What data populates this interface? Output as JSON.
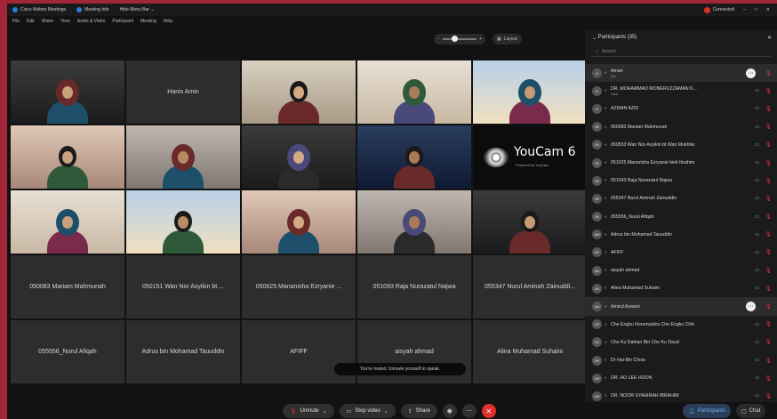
{
  "app": {
    "title_items": [
      "Cisco Webex Meetings",
      "Meeting Info",
      "Hide Menu Bar"
    ],
    "connection": "Connected",
    "window_controls": [
      "–",
      "□",
      "✕"
    ]
  },
  "menu": [
    "File",
    "Edit",
    "Share",
    "View",
    "Audio & Video",
    "Participant",
    "Meeting",
    "Help"
  ],
  "grid_controls": {
    "layout_label": "Layout"
  },
  "tiles": [
    {
      "type": "video",
      "label": ""
    },
    {
      "type": "name",
      "label": "Hanis Amin"
    },
    {
      "type": "video",
      "label": ""
    },
    {
      "type": "video",
      "label": ""
    },
    {
      "type": "video",
      "label": ""
    },
    {
      "type": "video",
      "label": ""
    },
    {
      "type": "video",
      "label": ""
    },
    {
      "type": "video",
      "label": ""
    },
    {
      "type": "video",
      "label": ""
    },
    {
      "type": "youcam",
      "label": "YouCam 6",
      "sub": "Powered by YouCam"
    },
    {
      "type": "video",
      "label": ""
    },
    {
      "type": "video",
      "label": ""
    },
    {
      "type": "video",
      "label": ""
    },
    {
      "type": "video",
      "label": ""
    },
    {
      "type": "video",
      "label": ""
    },
    {
      "type": "name",
      "label": "050083 Mariam Mahmunah"
    },
    {
      "type": "name",
      "label": "050151 Wan Nor Asyikin bt ..."
    },
    {
      "type": "name",
      "label": "050625 Mananisha Ezryanie ..."
    },
    {
      "type": "name",
      "label": "051093 Raja Nurazatul Najwa"
    },
    {
      "type": "name",
      "label": "055347 Nurul Aminah Zainuddi..."
    },
    {
      "type": "name",
      "label": "055556_Nurul Afiqah"
    },
    {
      "type": "name",
      "label": "Adrus bin Mohamad Tauuddin"
    },
    {
      "type": "name",
      "label": "AFIFF"
    },
    {
      "type": "name",
      "label": "aisyah ahmad"
    },
    {
      "type": "name",
      "label": "Alina Muhamad Suhaini"
    }
  ],
  "toast": "You're muted. Unmute yourself to speak.",
  "controls": {
    "mute": "Unmute",
    "video": "Stop video",
    "share": "Share"
  },
  "side_buttons": {
    "participants": "Participants",
    "chat": "Chat"
  },
  "participants": {
    "title": "Participants (35)",
    "search_placeholder": "Search",
    "rows": [
      {
        "initials": "A",
        "name": "Aman",
        "role": "Me",
        "sel": true,
        "more": true
      },
      {
        "initials": "D",
        "name": "DR. MOHAMMAD MONERUZZAMAN K...",
        "role": "Host"
      },
      {
        "initials": "A",
        "name": "AZMAN AZID"
      },
      {
        "initials": "05",
        "name": "050083 Mariam Mahmunah"
      },
      {
        "initials": "05",
        "name": "050553 Wan Nor Asyikin bt Wan Mukhtar"
      },
      {
        "initials": "05",
        "name": "051025 Manarisha Ezryanie binti Ibrahim"
      },
      {
        "initials": "05",
        "name": "051093 Raja Nurazatul Najwa"
      },
      {
        "initials": "05",
        "name": "055347 Nurul Aminah Zainuddin"
      },
      {
        "initials": "05",
        "name": "055556_Nurul Afiqah"
      },
      {
        "initials": "AM",
        "name": "Adrus bin Mohamad Tauuddin"
      },
      {
        "initials": "AF",
        "name": "AFIFF"
      },
      {
        "initials": "AA",
        "name": "aisyah ahmad"
      },
      {
        "initials": "AS",
        "name": "Alina Muhamad Suhaini"
      },
      {
        "initials": "AA",
        "name": "Amirul Azwani",
        "sel": true,
        "more": true
      },
      {
        "initials": "CE",
        "name": "Che Engku Norumaidza Che Engku Chik"
      },
      {
        "initials": "CK",
        "name": "Che Ku Dahlan Bin Che Ku Daud"
      },
      {
        "initials": "DR",
        "name": "Dr Hai-Bin Chow"
      },
      {
        "initials": "DH",
        "name": "DR. HO LEE HOON"
      },
      {
        "initials": "DN",
        "name": "DR. NOOR SYAHIRAH IBRAHIM"
      }
    ]
  },
  "colors": {
    "accent": "#2a7de1",
    "end": "#e0312d",
    "mute": "#ee3333"
  }
}
